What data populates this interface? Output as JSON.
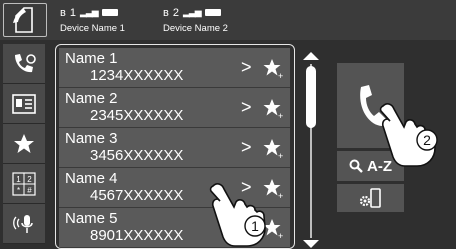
{
  "status": {
    "device1_index": "1",
    "device1_name": "Device Name 1",
    "device2_index": "2",
    "device2_name": "Device Name 2"
  },
  "left_icons": [
    "phone-settings-icon",
    "phonebook-icon",
    "favorite-star-icon",
    "dialpad-icon",
    "voice-dial-icon"
  ],
  "dialpad_label": "1 2\n* #",
  "contacts": [
    {
      "name": "Name 1",
      "number": "1234XXXXXX"
    },
    {
      "name": "Name 2",
      "number": "2345XXXXXX"
    },
    {
      "name": "Name 3",
      "number": "3456XXXXXX"
    },
    {
      "name": "Name 4",
      "number": "4567XXXXXX"
    },
    {
      "name": "Name 5",
      "number": "8901XXXXXX"
    }
  ],
  "chevron": ">",
  "az_label": "A-Z",
  "callouts": {
    "one": "1",
    "two": "2"
  },
  "colors": {
    "background": "#2f2f2f",
    "row": "#5a5a5a",
    "button": "#545454"
  }
}
